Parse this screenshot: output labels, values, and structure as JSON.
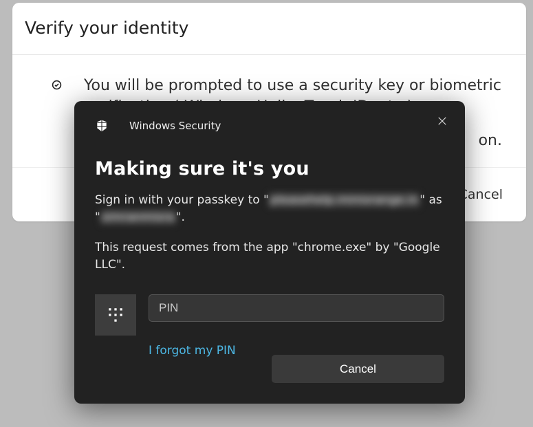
{
  "card": {
    "title": "Verify your identity",
    "body_text": "You will be prompted to use a security key or biometric verification ( Windows Hello, Touch ID, etc.)",
    "body_tail": "on.",
    "cancel_label": "Cancel"
  },
  "dialog": {
    "app_title": "Windows Security",
    "heading": "Making sure it's you",
    "passkey_prefix": "Sign in with your passkey to \"",
    "passkey_domain_blurred": "pleasehelp.miniorange.in",
    "passkey_mid": "\" as \"",
    "passkey_user_blurred": "simranmisra",
    "passkey_suffix": "\".",
    "request_source": "This request comes from the app \"chrome.exe\" by \"Google LLC\".",
    "pin_placeholder": "PIN",
    "forgot_pin": "I forgot my PIN",
    "cancel_label": "Cancel"
  }
}
